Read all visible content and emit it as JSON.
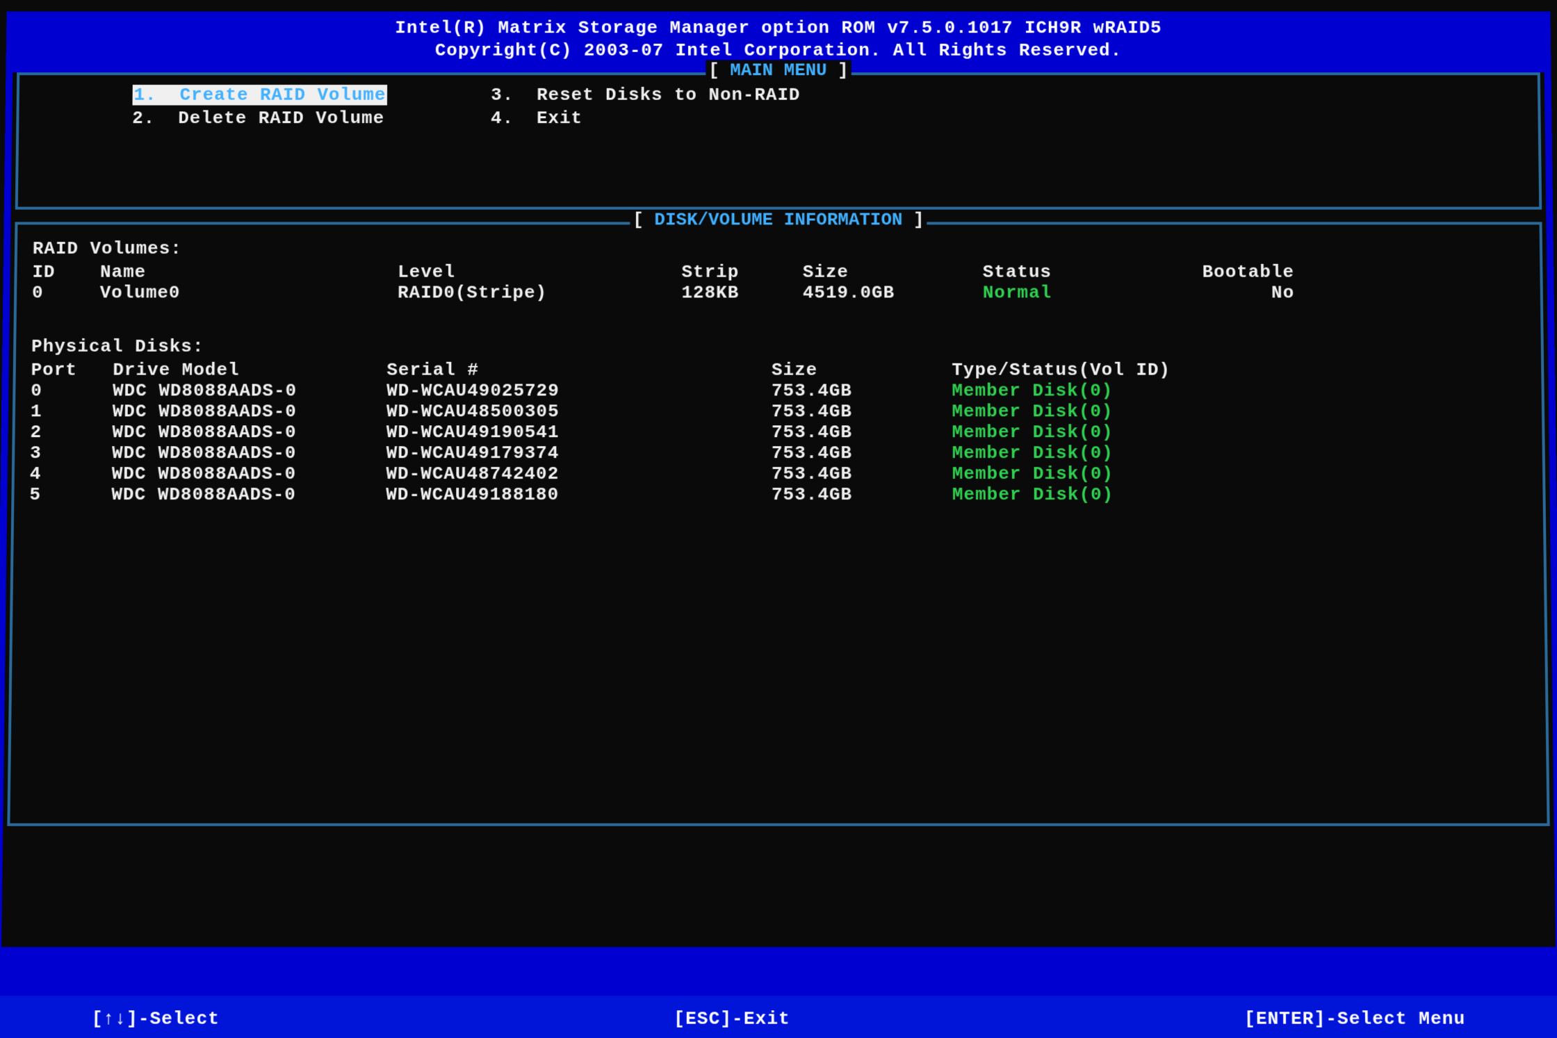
{
  "header": {
    "line1": "Intel(R) Matrix Storage Manager option ROM v7.5.0.1017 ICH9R wRAID5",
    "line2": "Copyright(C) 2003-07 Intel Corporation.  All Rights Reserved."
  },
  "main_menu": {
    "title": "MAIN MENU",
    "items": [
      {
        "num": "1.",
        "label": "Create RAID Volume",
        "selected": true
      },
      {
        "num": "2.",
        "label": "Delete RAID Volume",
        "selected": false
      },
      {
        "num": "3.",
        "label": "Reset Disks to Non-RAID",
        "selected": false
      },
      {
        "num": "4.",
        "label": "Exit",
        "selected": false
      }
    ]
  },
  "info": {
    "title": "DISK/VOLUME INFORMATION",
    "volumes_label": "RAID Volumes:",
    "vol_headers": {
      "id": "ID",
      "name": "Name",
      "level": "Level",
      "strip": "Strip",
      "size": "Size",
      "status": "Status",
      "bootable": "Bootable"
    },
    "volumes": [
      {
        "id": "0",
        "name": "Volume0",
        "level": "RAID0(Stripe)",
        "strip": "128KB",
        "size": "4519.0GB",
        "status": "Normal",
        "bootable": "No"
      }
    ],
    "disks_label": "Physical Disks:",
    "disk_headers": {
      "port": "Port",
      "model": "Drive Model",
      "serial": "Serial #",
      "size": "Size",
      "type": "Type/Status(Vol ID)"
    },
    "disks": [
      {
        "port": "0",
        "model": "WDC WD8088AADS-0",
        "serial": "WD-WCAU49025729",
        "size": "753.4GB",
        "type": "Member Disk(0)"
      },
      {
        "port": "1",
        "model": "WDC WD8088AADS-0",
        "serial": "WD-WCAU48500305",
        "size": "753.4GB",
        "type": "Member Disk(0)"
      },
      {
        "port": "2",
        "model": "WDC WD8088AADS-0",
        "serial": "WD-WCAU49190541",
        "size": "753.4GB",
        "type": "Member Disk(0)"
      },
      {
        "port": "3",
        "model": "WDC WD8088AADS-0",
        "serial": "WD-WCAU49179374",
        "size": "753.4GB",
        "type": "Member Disk(0)"
      },
      {
        "port": "4",
        "model": "WDC WD8088AADS-0",
        "serial": "WD-WCAU48742402",
        "size": "753.4GB",
        "type": "Member Disk(0)"
      },
      {
        "port": "5",
        "model": "WDC WD8088AADS-0",
        "serial": "WD-WCAU49188180",
        "size": "753.4GB",
        "type": "Member Disk(0)"
      }
    ]
  },
  "footer": {
    "select": "[↑↓]-Select",
    "exit": "[ESC]-Exit",
    "enter": "[ENTER]-Select Menu"
  }
}
